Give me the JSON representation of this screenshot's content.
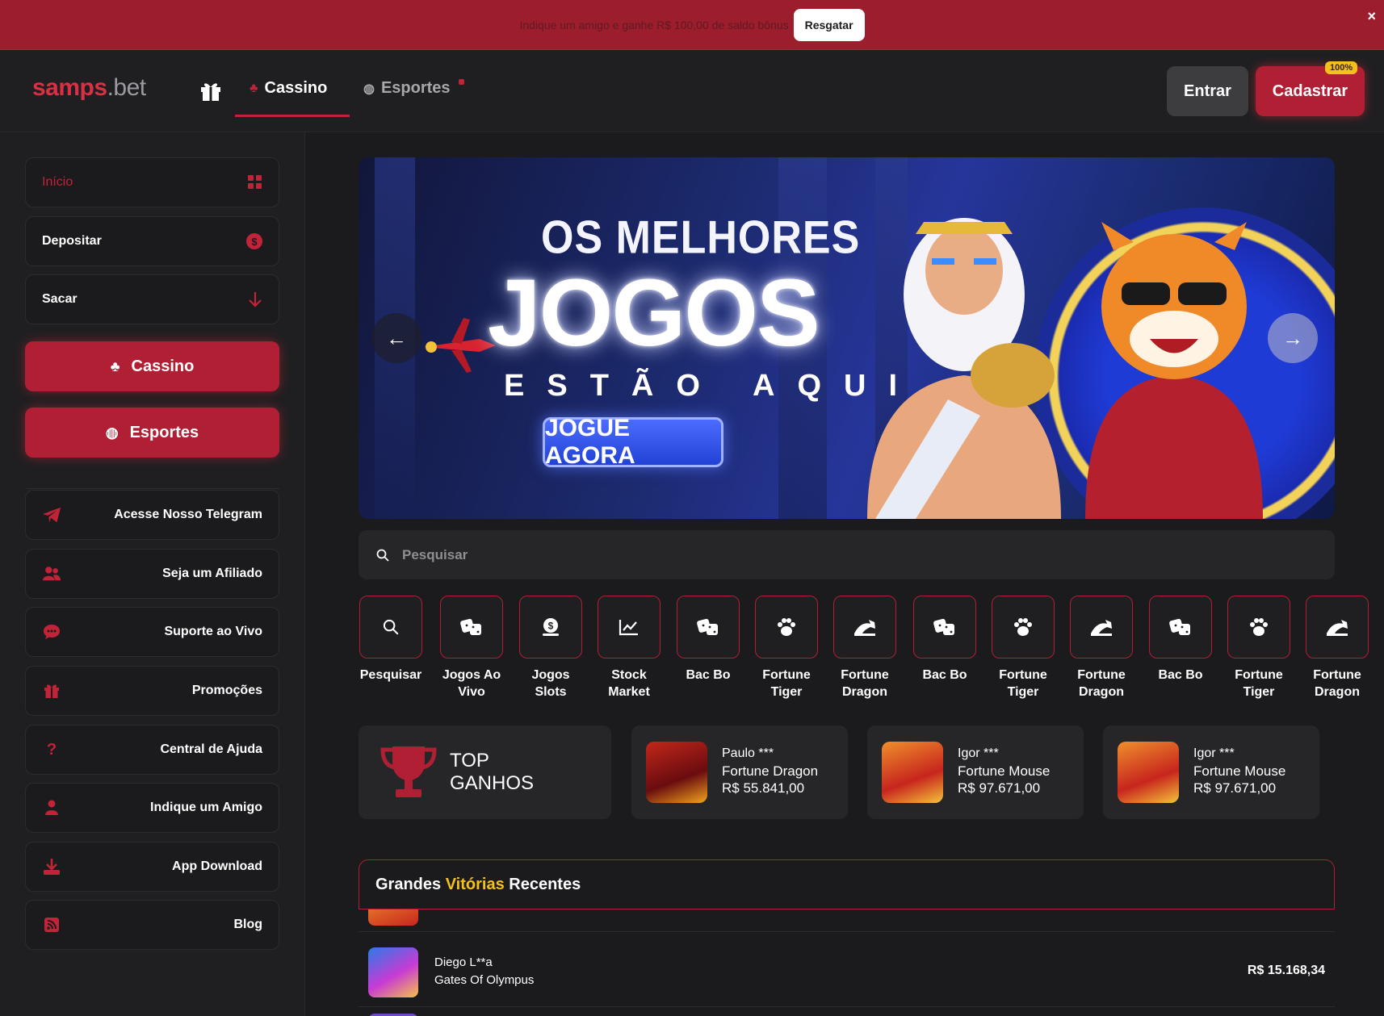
{
  "promo": {
    "text": "Indique um amigo e ganhe R$ 100,00 de saldo bônus",
    "button": "Resgatar",
    "close": "×"
  },
  "header": {
    "logo_part1": "samps",
    "logo_part2": ".bet",
    "tabs": [
      {
        "label": "Cassino",
        "active": true
      },
      {
        "label": "Esportes",
        "active": false
      }
    ],
    "login": "Entrar",
    "register": "Cadastrar",
    "register_badge": "100%"
  },
  "sidebar": {
    "top_items": [
      {
        "label": "Início",
        "icon": "grid-icon"
      },
      {
        "label": "Depositar",
        "icon": "dollar-icon"
      },
      {
        "label": "Sacar",
        "icon": "arrow-down-icon"
      }
    ],
    "big_buttons": [
      {
        "label": "Cassino",
        "icon": "club-icon"
      },
      {
        "label": "Esportes",
        "icon": "ball-icon"
      }
    ],
    "links": [
      {
        "label": "Acesse Nosso Telegram",
        "icon": "telegram-icon"
      },
      {
        "label": "Seja um Afiliado",
        "icon": "users-icon"
      },
      {
        "label": "Suporte ao Vivo",
        "icon": "chat-icon"
      },
      {
        "label": "Promoções",
        "icon": "gift-icon"
      },
      {
        "label": "Central de Ajuda",
        "icon": "question-icon"
      },
      {
        "label": "Indique um Amigo",
        "icon": "user-icon"
      },
      {
        "label": "App Download",
        "icon": "download-icon"
      },
      {
        "label": "Blog",
        "icon": "rss-icon"
      }
    ]
  },
  "hero": {
    "line1": "OS MELHORES",
    "line2": "JOGOS",
    "line3": "ESTÃO AQUI",
    "cta": "JOGUE AGORA",
    "prev": "←",
    "next": "→"
  },
  "search": {
    "placeholder": "Pesquisar"
  },
  "categories": [
    {
      "label": "Pesquisar",
      "icon": "search-icon"
    },
    {
      "label": "Jogos Ao Vivo",
      "icon": "dice-icon"
    },
    {
      "label": "Jogos Slots",
      "icon": "coin-icon"
    },
    {
      "label": "Stock Market",
      "icon": "chart-icon"
    },
    {
      "label": "Bac Bo",
      "icon": "dice-icon"
    },
    {
      "label": "Fortune Tiger",
      "icon": "paw-icon"
    },
    {
      "label": "Fortune Dragon",
      "icon": "dragon-icon"
    },
    {
      "label": "Bac Bo",
      "icon": "dice-icon"
    },
    {
      "label": "Fortune Tiger",
      "icon": "paw-icon"
    },
    {
      "label": "Fortune Dragon",
      "icon": "dragon-icon"
    },
    {
      "label": "Bac Bo",
      "icon": "dice-icon"
    },
    {
      "label": "Fortune Tiger",
      "icon": "paw-icon"
    },
    {
      "label": "Fortune Dragon",
      "icon": "dragon-icon"
    }
  ],
  "top_ganhos": {
    "line1": "TOP",
    "line2": "GANHOS",
    "wins": [
      {
        "name": "Paulo ***",
        "game": "Fortune Dragon",
        "amount": "R$ 55.841,00"
      },
      {
        "name": "Igor ***",
        "game": "Fortune Mouse",
        "amount": "R$ 97.671,00"
      },
      {
        "name": "Igor ***",
        "game": "Fortune Mouse",
        "amount": "R$ 97.671,00"
      }
    ]
  },
  "recent": {
    "title_a": "Grandes ",
    "title_b": "Vitórias",
    "title_c": " Recentes",
    "rows": [
      {
        "name": "Diego L**a",
        "game": "Gates Of Olympus",
        "amount": "R$ 15.168,34"
      }
    ]
  },
  "colors": {
    "accent": "#b01f33",
    "highlight": "#f4c01a",
    "background": "#1b1b1d"
  }
}
